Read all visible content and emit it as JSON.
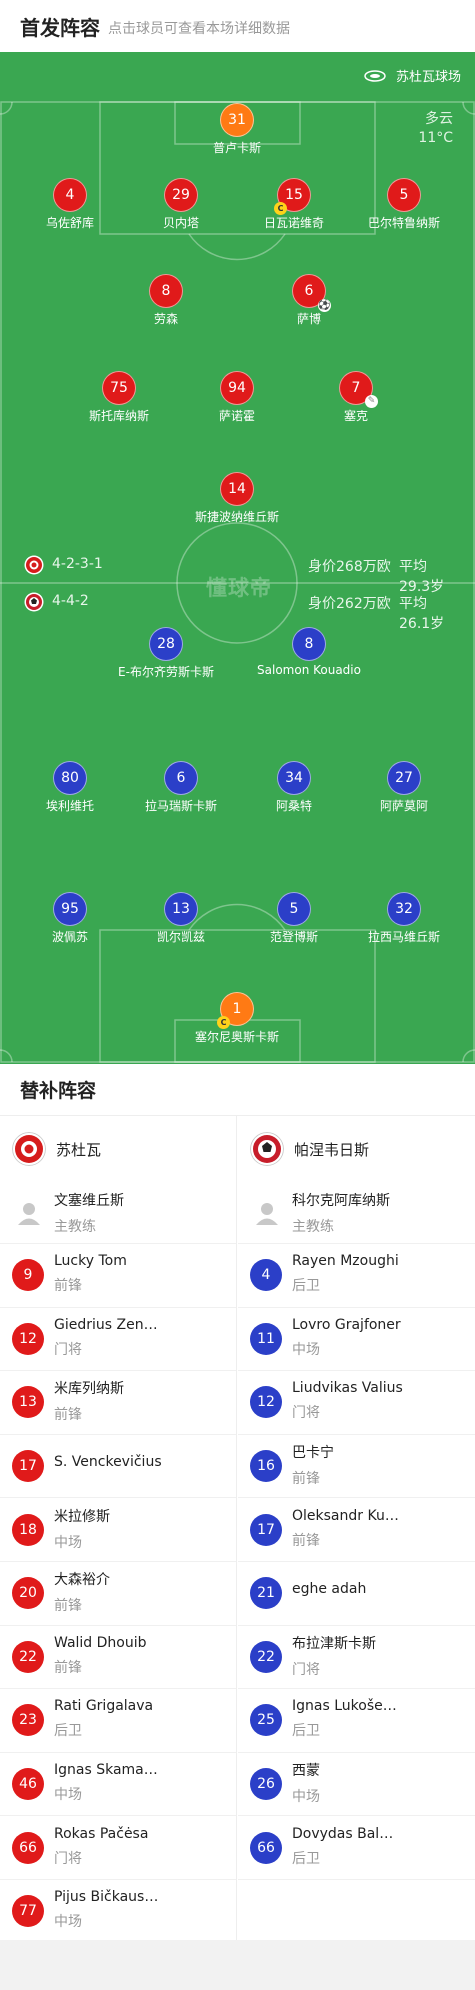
{
  "header": {
    "title": "首发阵容",
    "subtitle": "点击球员可查看本场详细数据"
  },
  "field": {
    "stadium": "苏杜瓦球场",
    "weather": "多云",
    "temperature": "11°C",
    "watermark": "懂球帝",
    "home_team_row": {
      "formation": "4-2-3-1",
      "value": "身价268万欧",
      "avg_age": "平均29.3岁"
    },
    "away_team_row": {
      "formation": "4-4-2",
      "value": "身价262万欧",
      "avg_age": "平均26.1岁"
    },
    "home_players": [
      {
        "number": "31",
        "name": "普卢卡斯"
      },
      {
        "number": "4",
        "name": "乌佐舒库"
      },
      {
        "number": "29",
        "name": "贝内塔"
      },
      {
        "number": "15",
        "name": "日瓦诺维奇"
      },
      {
        "number": "5",
        "name": "巴尔特鲁纳斯"
      },
      {
        "number": "8",
        "name": "劳森"
      },
      {
        "number": "6",
        "name": "萨博"
      },
      {
        "number": "75",
        "name": "斯托库纳斯"
      },
      {
        "number": "94",
        "name": "萨诺霍"
      },
      {
        "number": "7",
        "name": "塞克"
      },
      {
        "number": "14",
        "name": "斯捷波纳维丘斯"
      }
    ],
    "away_players": [
      {
        "number": "28",
        "name": "E-布尔齐劳斯卡斯"
      },
      {
        "number": "8",
        "name": "Salomon Kouadio"
      },
      {
        "number": "80",
        "name": "埃利维托"
      },
      {
        "number": "6",
        "name": "拉马瑞斯卡斯"
      },
      {
        "number": "34",
        "name": "阿桑特"
      },
      {
        "number": "27",
        "name": "阿萨莫阿"
      },
      {
        "number": "95",
        "name": "波佩苏"
      },
      {
        "number": "13",
        "name": "凯尔凯兹"
      },
      {
        "number": "5",
        "name": "范登博斯"
      },
      {
        "number": "32",
        "name": "拉西马维丘斯"
      },
      {
        "number": "1",
        "name": "塞尔尼奥斯卡斯"
      }
    ],
    "captain_badge": "C"
  },
  "subs": {
    "title": "替补阵容",
    "home": {
      "team": "苏杜瓦",
      "coach": {
        "name": "文塞维丘斯",
        "role": "主教练"
      },
      "players": [
        {
          "number": "9",
          "name": "Lucky Tom",
          "pos": "前锋"
        },
        {
          "number": "12",
          "name": "Giedrius Zen…",
          "pos": "门将"
        },
        {
          "number": "13",
          "name": "米库列纳斯",
          "pos": "前锋"
        },
        {
          "number": "17",
          "name": "S. Venckevičius",
          "pos": ""
        },
        {
          "number": "18",
          "name": "米拉修斯",
          "pos": "中场"
        },
        {
          "number": "20",
          "name": "大森裕介",
          "pos": "前锋"
        },
        {
          "number": "22",
          "name": "Walid Dhouib",
          "pos": "前锋"
        },
        {
          "number": "23",
          "name": "Rati Grigalava",
          "pos": "后卫"
        },
        {
          "number": "46",
          "name": "Ignas Skama…",
          "pos": "中场"
        },
        {
          "number": "66",
          "name": "Rokas Pačėsa",
          "pos": "门将"
        },
        {
          "number": "77",
          "name": "Pijus Bičkaus…",
          "pos": "中场"
        }
      ]
    },
    "away": {
      "team": "帕涅韦日斯",
      "coach": {
        "name": "科尔克阿库纳斯",
        "role": "主教练"
      },
      "players": [
        {
          "number": "4",
          "name": "Rayen Mzoughi",
          "pos": "后卫"
        },
        {
          "number": "11",
          "name": "Lovro Grajfoner",
          "pos": "中场"
        },
        {
          "number": "12",
          "name": "Liudvikas Valius",
          "pos": "门将"
        },
        {
          "number": "16",
          "name": "巴卡宁",
          "pos": "前锋"
        },
        {
          "number": "17",
          "name": "Oleksandr Ku…",
          "pos": "前锋"
        },
        {
          "number": "21",
          "name": "eghe adah",
          "pos": ""
        },
        {
          "number": "22",
          "name": "布拉津斯卡斯",
          "pos": "门将"
        },
        {
          "number": "25",
          "name": "Ignas Lukoše…",
          "pos": "后卫"
        },
        {
          "number": "26",
          "name": "西蒙",
          "pos": "中场"
        },
        {
          "number": "66",
          "name": "Dovydas Bal…",
          "pos": "后卫"
        }
      ]
    }
  },
  "colors": {
    "pitch": "#3aa751",
    "home": "#e01a1a",
    "away": "#2b3fc8",
    "goalkeeper": "#ff7a14"
  }
}
